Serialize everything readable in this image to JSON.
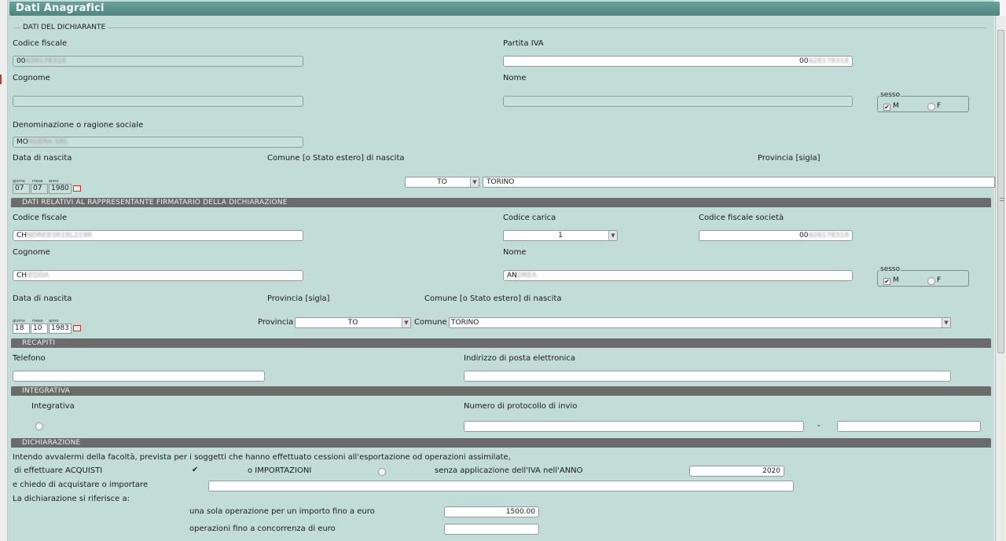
{
  "window": {
    "title": "Dati Anagrafici"
  },
  "dichiarante": {
    "legend": "DATI DEL DICHIARANTE",
    "codice_fiscale_label": "Codice fiscale",
    "codice_fiscale_prefix": "00",
    "codice_fiscale_blur": "428178318",
    "partita_iva_label": "Partita IVA",
    "partita_iva_prefix": "00",
    "partita_iva_blur": "428178318",
    "cognome_label": "Cognome",
    "nome_label": "Nome",
    "sesso_label": "sesso",
    "sesso_m": "M",
    "sesso_f": "F",
    "denominazione_label": "Denominazione o ragione sociale",
    "denominazione_prefix": "MO",
    "denominazione_blur": "RGERA SRL",
    "data_nascita_label": "Data di nascita",
    "comune_nascita_label": "Comune [o Stato estero] di nascita",
    "provincia_label": "Provincia [sigla]",
    "giorno_label": "giorno",
    "mese_label": "mese",
    "anno_label": "anno",
    "giorno": "07",
    "mese": "07",
    "anno": "1980",
    "provincia": "TO",
    "comune": "TORINO"
  },
  "rappresentante": {
    "title": "DATI RELATIVI AL RAPPRESENTANTE FIRMATARIO DELLA DICHIARAZIONE",
    "codice_fiscale_label": "Codice fiscale",
    "codice_fiscale_prefix": "CH",
    "codice_fiscale_blur": "NDRE83R18L219R",
    "codice_carica_label": "Codice carica",
    "codice_carica": "1",
    "cf_societa_label": "Codice fiscale società",
    "cf_societa_prefix": "00",
    "cf_societa_blur": "428178318",
    "cognome_label": "Cognome",
    "cognome_prefix": "CH",
    "cognome_blur": "IEDDA",
    "nome_label": "Nome",
    "nome_prefix": "AN",
    "nome_blur": "DREA",
    "sesso_label": "sesso",
    "sesso_m": "M",
    "sesso_f": "F",
    "data_nascita_label": "Data di nascita",
    "provincia_sigla_label": "Provincia [sigla]",
    "comune_nascita_label": "Comune [o Stato estero] di nascita",
    "giorno_label": "giorno",
    "mese_label": "mese",
    "anno_label": "anno",
    "giorno": "18",
    "mese": "10",
    "anno": "1983",
    "provincia_inline_label": "Provincia",
    "provincia": "TO",
    "comune_inline_label": "Comune",
    "comune": "TORINO"
  },
  "recapiti": {
    "title": "RECAPITI",
    "telefono_label": "Telefono",
    "email_label": "Indirizzo di posta elettronica"
  },
  "integrativa": {
    "title": "INTEGRATIVA",
    "integrativa_label": "Integrativa",
    "protocollo_label": "Numero di protocollo di invio",
    "dash": "-"
  },
  "dichiarazione": {
    "title": "DICHIARAZIONE",
    "intro": "Intendo avvalermi della facoltà, prevista per i soggetti che hanno effettuato cessioni all'esportazione od operazioni assimilate,",
    "acquisti_label": "di effettuare ACQUISTI",
    "importazioni_label": "o IMPORTAZIONI",
    "senza_iva_label": "senza applicazione dell'IVA nell'ANNO",
    "anno": "2020",
    "chiedo_label": "e chiedo di acquistare o importare",
    "riferisce_label": "La dichiarazione si riferisce a:",
    "sola_operazione_label": "una sola operazione per un importo fino a euro",
    "sola_operazione_value": "1500.00",
    "concorrenza_label": "operazioni fino a concorrenza di euro"
  }
}
